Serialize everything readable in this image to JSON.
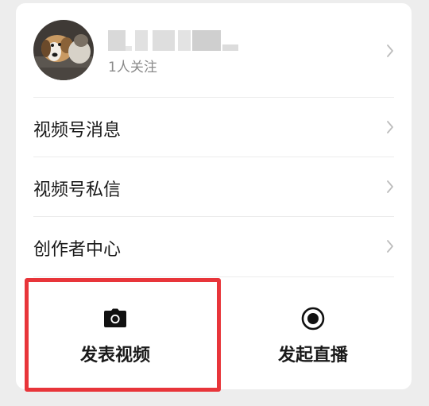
{
  "profile": {
    "followers_text": "1人关注"
  },
  "menu": {
    "items": [
      {
        "label": "视频号消息"
      },
      {
        "label": "视频号私信"
      },
      {
        "label": "创作者中心"
      }
    ]
  },
  "actions": {
    "post_video_label": "发表视频",
    "start_live_label": "发起直播"
  },
  "colors": {
    "highlight": "#e8353a",
    "background": "#ededed",
    "card": "#ffffff"
  },
  "icons": {
    "post_video": "camera-icon",
    "start_live": "live-record-icon",
    "row_arrow": "chevron-right-icon"
  }
}
